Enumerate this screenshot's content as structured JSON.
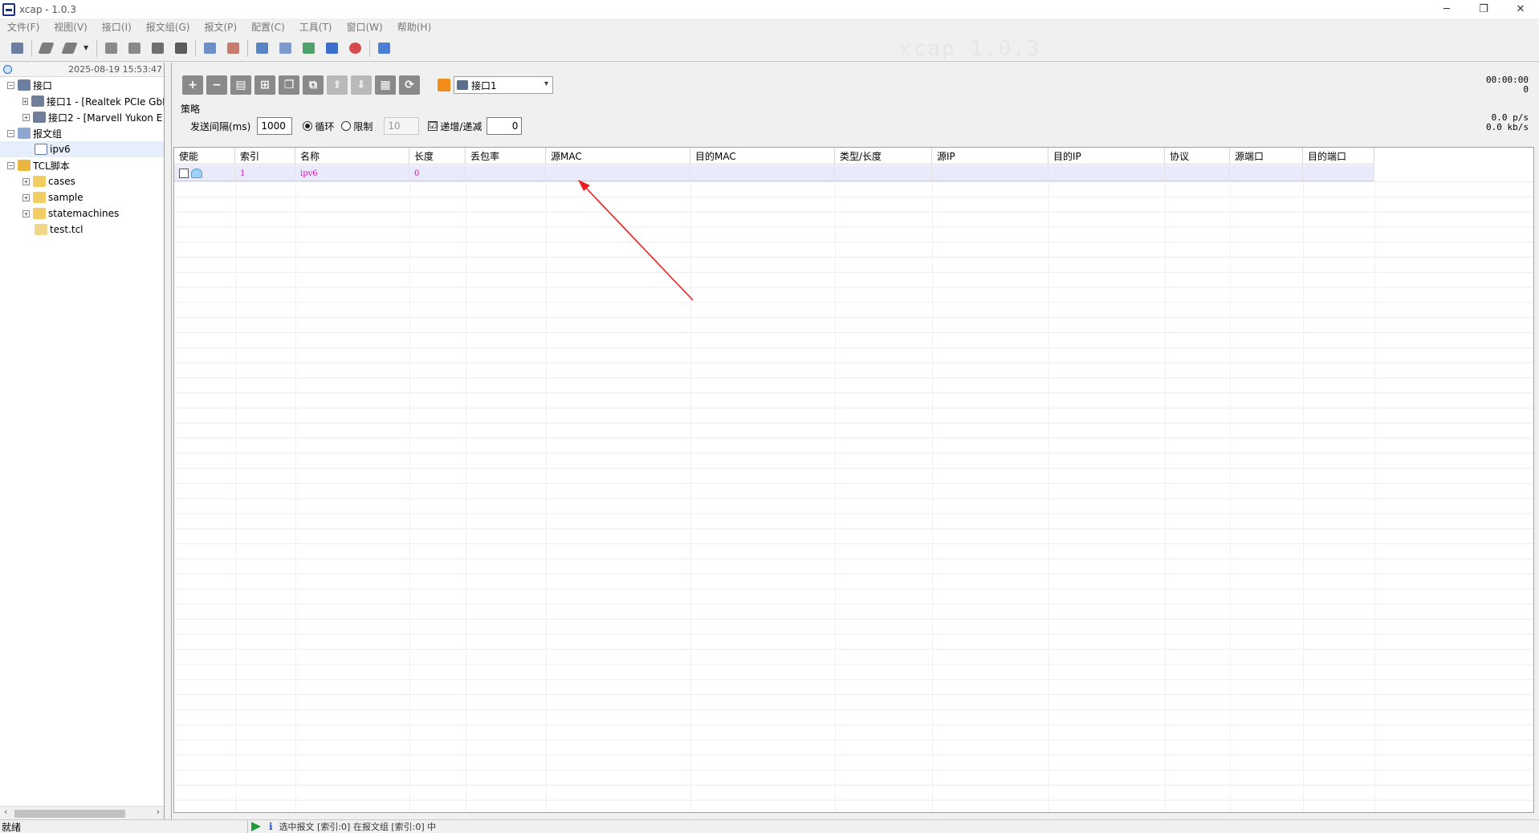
{
  "window": {
    "title": "xcap - 1.0.3",
    "minimize": "─",
    "restore": "❐",
    "close": "✕"
  },
  "menu": [
    "文件(F)",
    "视图(V)",
    "接口(I)",
    "报文组(G)",
    "报文(P)",
    "配置(C)",
    "工具(T)",
    "窗口(W)",
    "帮助(H)"
  ],
  "watermark": "xcap 1.0.3",
  "left_panel": {
    "timestamp": "2025-08-19 15:53:47",
    "tree": {
      "interfaces": "接口",
      "iface1": "接口1 - [Realtek PCIe GbE",
      "iface2": "接口2 - [Marvell Yukon E",
      "groups": "报文组",
      "group_ipv6": "ipv6",
      "tcl": "TCL脚本",
      "cases": "cases",
      "sample": "sample",
      "statemachines": "statemachines",
      "testtcl": "test.tcl"
    },
    "scroll_left": "‹",
    "scroll_right": "›"
  },
  "right_panel": {
    "buttons": {
      "add": "+",
      "remove": "−",
      "edit": "▤",
      "split": "⊞",
      "copy": "❐",
      "paste": "⧉",
      "up": "⬆",
      "down": "⬇",
      "grid": "▦",
      "loop": "⟳"
    },
    "interface_selected": "接口1",
    "dropdown_caret": "▾",
    "timer": "00:00:00",
    "counter": "0",
    "rate_pps": "0.0  p/s",
    "rate_kbs": "0.0 kb/s",
    "policy_title": "策略",
    "interval_label": "发送间隔(ms)",
    "interval_value": "1000",
    "loop_label": "循环",
    "limit_label": "限制",
    "limit_value": "10",
    "incdec_check": "☑",
    "incdec_label": "递增/递减",
    "incdec_value": "0"
  },
  "table": {
    "headers": [
      "使能",
      "索引",
      "名称",
      "长度",
      "丢包率",
      "源MAC",
      "目的MAC",
      "类型/长度",
      "源IP",
      "目的IP",
      "协议",
      "源端口",
      "目的端口"
    ],
    "rows": [
      {
        "index": "1",
        "name": "ipv6",
        "length": "0"
      }
    ]
  },
  "status": {
    "left": "就绪",
    "message": "选中报文 [索引:0] 在报文组 [索引:0] 中",
    "info_glyph": "i"
  }
}
